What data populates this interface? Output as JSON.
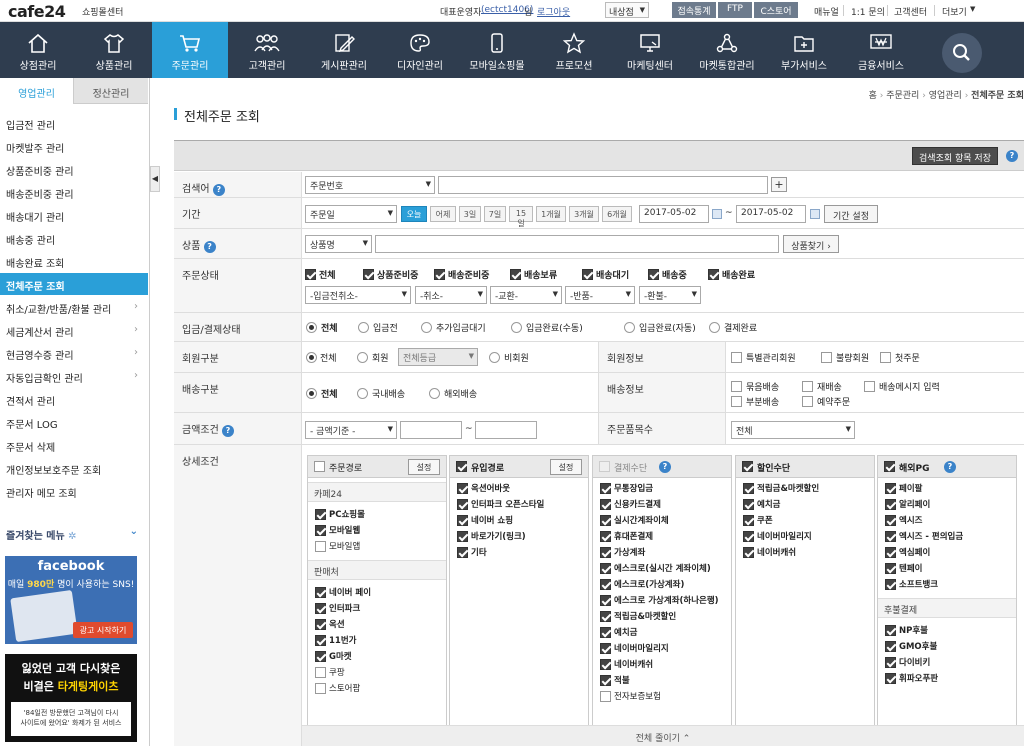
{
  "topbar": {
    "logo": "cafe24",
    "logo_sub": "쇼핑몰센터",
    "admin_label": "대표운영자",
    "admin_id": "(ectct1406)",
    "admin_suffix": "님",
    "logout": "로그아웃",
    "store_select": "내상점",
    "buttons": [
      "접속통계",
      "FTP",
      "C스토어"
    ],
    "links": [
      "매뉴얼",
      "1:1 문의",
      "고객센터",
      "더보기"
    ]
  },
  "nav": {
    "items": [
      {
        "label": "상점관리",
        "icon": "home-icon"
      },
      {
        "label": "상품관리",
        "icon": "shirt-icon"
      },
      {
        "label": "주문관리",
        "icon": "cart-icon"
      },
      {
        "label": "고객관리",
        "icon": "users-icon"
      },
      {
        "label": "게시판관리",
        "icon": "pencil-board-icon"
      },
      {
        "label": "디자인관리",
        "icon": "palette-icon"
      },
      {
        "label": "모바일쇼핑몰",
        "icon": "mobile-icon"
      },
      {
        "label": "프로모션",
        "icon": "star-icon"
      },
      {
        "label": "마케팅센터",
        "icon": "monitor-icon"
      },
      {
        "label": "마켓통합관리",
        "icon": "network-icon"
      },
      {
        "label": "부가서비스",
        "icon": "folder-plus-icon"
      },
      {
        "label": "금융서비스",
        "icon": "finance-icon"
      }
    ],
    "active": "주문관리"
  },
  "sidebar": {
    "tabs": [
      "영업관리",
      "정산관리"
    ],
    "items": [
      {
        "label": "입금전 관리",
        "arrow": false
      },
      {
        "label": "마켓발주 관리",
        "arrow": false
      },
      {
        "label": "상품준비중 관리",
        "arrow": false
      },
      {
        "label": "배송준비중 관리",
        "arrow": false
      },
      {
        "label": "배송대기 관리",
        "arrow": false
      },
      {
        "label": "배송중 관리",
        "arrow": false
      },
      {
        "label": "배송완료 조회",
        "arrow": false
      },
      {
        "label": "전체주문 조회",
        "arrow": false,
        "active": true
      },
      {
        "label": "취소/교환/반품/환불 관리",
        "arrow": true
      },
      {
        "label": "세금계산서 관리",
        "arrow": true
      },
      {
        "label": "현금영수증 관리",
        "arrow": true
      },
      {
        "label": "자동입금확인 관리",
        "arrow": true
      },
      {
        "label": "견적서 관리",
        "arrow": false
      },
      {
        "label": "주문서 LOG",
        "arrow": false
      },
      {
        "label": "주문서 삭제",
        "arrow": false
      },
      {
        "label": "개인정보보호주문 조회",
        "arrow": false
      },
      {
        "label": "관리자 메모 조회",
        "arrow": false
      }
    ],
    "favorites": "즐겨찾는 메뉴",
    "fb_banner": {
      "title": "facebook",
      "line1a": "매일 ",
      "line1b": "980만",
      "line1c": " 명이 사용하는 SNS!",
      "cta": "광고 시작하기"
    },
    "ad_banner": {
      "line1": "잃었던 고객 다시찾은",
      "line2a": "비결은 ",
      "line2b": "타게팅게이츠",
      "line3": "'84일전 방문했던 고객님이 다시",
      "line4": "사이트에 왔어요' 화제가 된 서비스"
    }
  },
  "breadcrumb": [
    "홈",
    "주문관리",
    "영업관리",
    "전체주문 조회"
  ],
  "page_title": "전체주문 조회",
  "form": {
    "save_view_button": "검색조회 항목 저장",
    "search": {
      "label": "검색어",
      "select": "주문번호",
      "value": "",
      "add": "+"
    },
    "period": {
      "label": "기간",
      "select": "주문일",
      "presets": [
        "오늘",
        "어제",
        "3일",
        "7일",
        "15일",
        "1개월",
        "3개월",
        "6개월"
      ],
      "active_preset": "오늘",
      "from": "2017-05-02",
      "tilde": "~",
      "to": "2017-05-02",
      "set_button": "기간 설정"
    },
    "product": {
      "label": "상품",
      "select": "상품명",
      "value": "",
      "find_button": "상품찾기"
    },
    "order_status": {
      "label": "주문상태",
      "checks": [
        "전체",
        "상품준비중",
        "배송준비중",
        "배송보류",
        "배송대기",
        "배송중",
        "배송완료"
      ],
      "selects": [
        "-입금전취소-",
        "-취소-",
        "-교환-",
        "-반품-",
        "-환불-"
      ]
    },
    "payment_status": {
      "label": "입금/결제상태",
      "options": [
        "전체",
        "입금전",
        "추가입금대기",
        "입금완료(수동)",
        "입금완료(자동)",
        "결제완료"
      ],
      "selected": "전체"
    },
    "member_type": {
      "label": "회원구분",
      "options": [
        "전체",
        "회원",
        "비회원"
      ],
      "grade_select": "전체등급",
      "selected": "전체"
    },
    "member_info": {
      "label": "회원정보",
      "checks": [
        "특별관리회원",
        "불량회원",
        "첫주문"
      ]
    },
    "shipping_type": {
      "label": "배송구분",
      "options": [
        "전체",
        "국내배송",
        "해외배송"
      ],
      "selected": "전체"
    },
    "shipping_info": {
      "label": "배송정보",
      "checks_row1": [
        "묶음배송",
        "재배송",
        "배송메시지 입력"
      ],
      "checks_row2": [
        "부분배송",
        "예약주문"
      ]
    },
    "amount": {
      "label": "금액조건",
      "select": "- 금액기준 -",
      "from": "",
      "tilde": "~",
      "to": ""
    },
    "item_count": {
      "label": "주문품목수",
      "select": "전체"
    },
    "detail": {
      "label": "상세조건",
      "fold_label": "전체 줄이기",
      "panels": [
        {
          "title": "주문경로",
          "checked": false,
          "disabled": false,
          "has_help": false,
          "set_button": "설정",
          "groups": [
            {
              "name": "카페24",
              "items": [
                {
                  "label": "PC쇼핑몰",
                  "on": true
                },
                {
                  "label": "모바일웹",
                  "on": true
                },
                {
                  "label": "모바일앱",
                  "on": false
                }
              ]
            },
            {
              "name": "판매처",
              "items": [
                {
                  "label": "네이버 페이",
                  "on": true
                },
                {
                  "label": "인터파크",
                  "on": true
                },
                {
                  "label": "옥션",
                  "on": true
                },
                {
                  "label": "11번가",
                  "on": true
                },
                {
                  "label": "G마켓",
                  "on": true
                },
                {
                  "label": "쿠팡",
                  "on": false
                },
                {
                  "label": "스토어팜",
                  "on": false
                }
              ]
            }
          ]
        },
        {
          "title": "유입경로",
          "checked": true,
          "disabled": false,
          "has_help": false,
          "set_button": "설정",
          "groups": [
            {
              "name": "",
              "items": [
                {
                  "label": "옥션어바웃",
                  "on": true
                },
                {
                  "label": "인터파크 오픈스타일",
                  "on": true
                },
                {
                  "label": "네이버 쇼핑",
                  "on": true
                },
                {
                  "label": "바로가기(링크)",
                  "on": true
                },
                {
                  "label": "기타",
                  "on": true
                }
              ]
            }
          ]
        },
        {
          "title": "결제수단",
          "checked": false,
          "disabled": true,
          "has_help": true,
          "set_button": "",
          "groups": [
            {
              "name": "",
              "items": [
                {
                  "label": "무통장입금",
                  "on": true
                },
                {
                  "label": "신용카드결제",
                  "on": true
                },
                {
                  "label": "실시간계좌이체",
                  "on": true
                },
                {
                  "label": "휴대폰결제",
                  "on": true
                },
                {
                  "label": "가상계좌",
                  "on": true
                },
                {
                  "label": "에스크로(실시간 계좌이체)",
                  "on": true
                },
                {
                  "label": "에스크로(가상계좌)",
                  "on": true
                },
                {
                  "label": "에스크로 가상계좌(하나은행)",
                  "on": true
                },
                {
                  "label": "적립금&마켓할인",
                  "on": true
                },
                {
                  "label": "예치금",
                  "on": true
                },
                {
                  "label": "네이버마일리지",
                  "on": true
                },
                {
                  "label": "네이버캐쉬",
                  "on": true
                },
                {
                  "label": "적불",
                  "on": true
                },
                {
                  "label": "전자보증보험",
                  "on": false
                }
              ]
            }
          ]
        },
        {
          "title": "할인수단",
          "checked": true,
          "disabled": false,
          "has_help": false,
          "set_button": "",
          "groups": [
            {
              "name": "",
              "items": [
                {
                  "label": "적립금&마켓할인",
                  "on": true
                },
                {
                  "label": "예치금",
                  "on": true
                },
                {
                  "label": "쿠폰",
                  "on": true
                },
                {
                  "label": "네이버마일리지",
                  "on": true
                },
                {
                  "label": "네이버캐쉬",
                  "on": true
                }
              ]
            }
          ]
        },
        {
          "title": "해외PG",
          "checked": true,
          "disabled": false,
          "has_help": true,
          "set_button": "",
          "groups": [
            {
              "name": "",
              "items": [
                {
                  "label": "페이팔",
                  "on": true
                },
                {
                  "label": "알리페이",
                  "on": true
                },
                {
                  "label": "엑시즈",
                  "on": true
                },
                {
                  "label": "엑시즈 - 편의입금",
                  "on": true
                },
                {
                  "label": "엑심페이",
                  "on": true
                },
                {
                  "label": "텐페이",
                  "on": true
                },
                {
                  "label": "소프트뱅크",
                  "on": true
                }
              ]
            },
            {
              "name": "후불결제",
              "items": [
                {
                  "label": "NP후불",
                  "on": true
                },
                {
                  "label": "GMO후불",
                  "on": true
                },
                {
                  "label": "다이비키",
                  "on": true
                },
                {
                  "label": "휘파오푸판",
                  "on": true
                }
              ]
            }
          ]
        }
      ]
    }
  }
}
